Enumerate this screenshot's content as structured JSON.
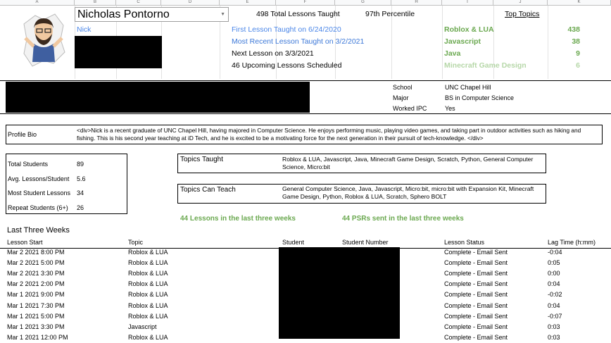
{
  "columns": [
    "A",
    "B",
    "C",
    "D",
    "E",
    "F",
    "G",
    "H",
    "I",
    "J",
    "K"
  ],
  "teacher": {
    "name": "Nicholas Pontorno",
    "nickname": "Nick",
    "total_lessons": "498 Total Lessons Taught",
    "percentile": "97th Percentile",
    "first_lesson": "First Lesson Taught on 6/24/2020",
    "recent_lesson": "Most Recent Lesson Taught on 3/2/2021",
    "next_lesson": "Next Lesson on 3/3/2021",
    "upcoming": "46 Upcoming Lessons Scheduled"
  },
  "top_topics": {
    "heading": "Top Topics",
    "items": [
      {
        "name": "Roblox & LUA",
        "count": "438"
      },
      {
        "name": "Javascript",
        "count": "38"
      },
      {
        "name": "Java",
        "count": "9"
      },
      {
        "name": "Minecraft Game Design",
        "count": "6"
      }
    ]
  },
  "education": [
    {
      "label": "School",
      "value": "UNC Chapel Hill"
    },
    {
      "label": "Major",
      "value": "BS in Computer Science"
    },
    {
      "label": "Worked IPC",
      "value": "Yes"
    }
  ],
  "profile": {
    "label": "Profile Bio",
    "bio": "<div>Nick is a recent graduate of UNC Chapel Hill, having majored in Computer Science. He enjoys performing music, playing video games, and taking part in outdoor activities such as hiking and fishing. This is his second year teaching at iD Tech, and he is excited to be a motivating force for the next generation in their pursuit of tech-knowledge. </div>"
  },
  "stats": [
    {
      "label": "Total Students",
      "value": "89"
    },
    {
      "label": "Avg. Lessons/Student",
      "value": "5.6"
    },
    {
      "label": "Most Student Lessons",
      "value": "34"
    },
    {
      "label": "Repeat Students (6+)",
      "value": "26"
    }
  ],
  "topics_taught": {
    "label": "Topics Taught",
    "value": "Roblox & LUA, Javascript, Java, Minecraft Game Design, Scratch, Python, General Computer Science, Micro:bit"
  },
  "topics_can_teach": {
    "label": "Topics Can Teach",
    "value": "General Computer Science, Java, Javascript, Micro:bit, micro:bit with Expansion Kit, Minecraft Game Design, Python, Roblox & LUA, Scratch, Sphero BOLT"
  },
  "summary": {
    "lessons_three_weeks": "44 Lessons in the last three weeks",
    "psrs_three_weeks": "44 PSRs sent in the last three weeks"
  },
  "last_three_weeks": {
    "title": "Last Three Weeks",
    "headers": [
      "Lesson Start",
      "Topic",
      "Student",
      "Student Number",
      "Lesson Status",
      "Lag Time (h:mm)"
    ],
    "rows": [
      {
        "start": "Mar 2 2021 8:00 PM",
        "topic": "Roblox & LUA",
        "status": "Complete - Email Sent",
        "lag": "-0:04"
      },
      {
        "start": "Mar 2 2021 5:00 PM",
        "topic": "Roblox & LUA",
        "status": "Complete - Email Sent",
        "lag": "0:05"
      },
      {
        "start": "Mar 2 2021 3:30 PM",
        "topic": "Roblox & LUA",
        "status": "Complete - Email Sent",
        "lag": "0:00"
      },
      {
        "start": "Mar 2 2021 2:00 PM",
        "topic": "Roblox & LUA",
        "status": "Complete - Email Sent",
        "lag": "0:04"
      },
      {
        "start": "Mar 1 2021 9:00 PM",
        "topic": "Roblox & LUA",
        "status": "Complete - Email Sent",
        "lag": "-0:02"
      },
      {
        "start": "Mar 1 2021 7:30 PM",
        "topic": "Roblox & LUA",
        "status": "Complete - Email Sent",
        "lag": "0:04"
      },
      {
        "start": "Mar 1 2021 5:00 PM",
        "topic": "Roblox & LUA",
        "status": "Complete - Email Sent",
        "lag": "-0:07"
      },
      {
        "start": "Mar 1 2021 3:30 PM",
        "topic": "Javascript",
        "status": "Complete - Email Sent",
        "lag": "0:03"
      },
      {
        "start": "Mar 1 2021 12:00 PM",
        "topic": "Roblox & LUA",
        "status": "Complete - Email Sent",
        "lag": "0:03"
      }
    ]
  },
  "colors": {
    "green": "#6aa84f",
    "light_green": "#b6d7a8",
    "blue": "#4a86e8",
    "redaction": "#000000"
  }
}
